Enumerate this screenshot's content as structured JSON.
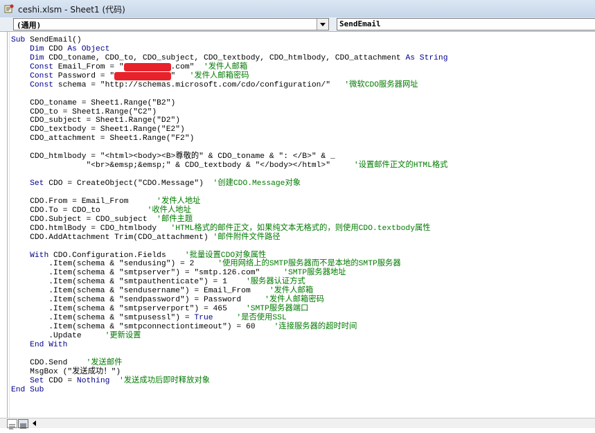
{
  "window": {
    "title": "ceshi.xlsm - Sheet1 (代码)"
  },
  "combos": {
    "object_value": "(通用)",
    "procedure_value": "SendEmail"
  },
  "colors": {
    "keyword": "#00008b",
    "comment": "#007a00",
    "text": "#000000",
    "redaction": "#e8222a"
  },
  "code_lines": [
    [
      {
        "t": "Sub ",
        "k": "kw"
      },
      {
        "t": "SendEmail()",
        "k": "tx"
      }
    ],
    [
      {
        "t": "    Dim ",
        "k": "kw"
      },
      {
        "t": "CDO ",
        "k": "tx"
      },
      {
        "t": "As Object",
        "k": "kw"
      }
    ],
    [
      {
        "t": "    Dim ",
        "k": "kw"
      },
      {
        "t": "CDO_toname, CDO_to, CDO_subject, CDO_textbody, CDO_htmlbody, CDO_attachment ",
        "k": "tx"
      },
      {
        "t": "As String",
        "k": "kw"
      }
    ],
    [
      {
        "t": "    Const ",
        "k": "kw"
      },
      {
        "t": "Email_From = \"",
        "k": "tx"
      },
      {
        "t": "xxxxxxxxxx",
        "k": "redact"
      },
      {
        "t": ".com\"  ",
        "k": "tx"
      },
      {
        "t": "'发件人邮箱",
        "k": "cm"
      }
    ],
    [
      {
        "t": "    Const ",
        "k": "kw"
      },
      {
        "t": "Password = \"",
        "k": "tx"
      },
      {
        "t": "xxxxxxxxxxxx",
        "k": "redact"
      },
      {
        "t": "\"   ",
        "k": "tx"
      },
      {
        "t": "'发件人邮箱密码",
        "k": "cm"
      }
    ],
    [
      {
        "t": "    Const ",
        "k": "kw"
      },
      {
        "t": "schema = \"http://schemas.microsoft.com/cdo/configuration/\"   ",
        "k": "tx"
      },
      {
        "t": "'微软CDO服务器网址",
        "k": "cm"
      }
    ],
    [
      {
        "t": "",
        "k": "tx"
      }
    ],
    [
      {
        "t": "    CDO_toname = Sheet1.Range(\"B2\")",
        "k": "tx"
      }
    ],
    [
      {
        "t": "    CDO_to = Sheet1.Range(\"C2\")",
        "k": "tx"
      }
    ],
    [
      {
        "t": "    CDO_subject = Sheet1.Range(\"D2\")",
        "k": "tx"
      }
    ],
    [
      {
        "t": "    CDO_textbody = Sheet1.Range(\"E2\")",
        "k": "tx"
      }
    ],
    [
      {
        "t": "    CDO_attachment = Sheet1.Range(\"F2\")",
        "k": "tx"
      }
    ],
    [
      {
        "t": "",
        "k": "tx"
      }
    ],
    [
      {
        "t": "    CDO_htmlbody = \"<html><body><B>尊敬的\" & CDO_toname & \": </B>\" & _",
        "k": "tx"
      }
    ],
    [
      {
        "t": "                \"<br>&emsp;&emsp;\" & CDO_textbody & \"</body></html>\"     ",
        "k": "tx"
      },
      {
        "t": "'设置邮件正文的HTML格式",
        "k": "cm"
      }
    ],
    [
      {
        "t": "",
        "k": "tx"
      }
    ],
    [
      {
        "t": "    Set ",
        "k": "kw"
      },
      {
        "t": "CDO = CreateObject(\"CDO.Message\")  ",
        "k": "tx"
      },
      {
        "t": "'创建CDO.Message对象",
        "k": "cm"
      }
    ],
    [
      {
        "t": "",
        "k": "tx"
      }
    ],
    [
      {
        "t": "    CDO.From = Email_From      ",
        "k": "tx"
      },
      {
        "t": "'发件人地址",
        "k": "cm"
      }
    ],
    [
      {
        "t": "    CDO.To = CDO_to          ",
        "k": "tx"
      },
      {
        "t": "'收件人地址",
        "k": "cm"
      }
    ],
    [
      {
        "t": "    CDO.Subject = CDO_subject  ",
        "k": "tx"
      },
      {
        "t": "'邮件主题",
        "k": "cm"
      }
    ],
    [
      {
        "t": "    CDO.htmlBody = CDO_htmlbody   ",
        "k": "tx"
      },
      {
        "t": "'HTML格式的邮件正文，如果纯文本无格式的，则使用CDO.textbody属性",
        "k": "cm"
      }
    ],
    [
      {
        "t": "    CDO.AddAttachment Trim(CDO_attachment) ",
        "k": "tx"
      },
      {
        "t": "'邮件附件文件路径",
        "k": "cm"
      }
    ],
    [
      {
        "t": "",
        "k": "tx"
      }
    ],
    [
      {
        "t": "    With ",
        "k": "kw"
      },
      {
        "t": "CDO.Configuration.Fields    ",
        "k": "tx"
      },
      {
        "t": "'批量设置CDO对象属性",
        "k": "cm"
      }
    ],
    [
      {
        "t": "        .Item(schema & \"sendusing\") = 2     ",
        "k": "tx"
      },
      {
        "t": "'使用网络上的SMTP服务器而不是本地的SMTP服务器",
        "k": "cm"
      }
    ],
    [
      {
        "t": "        .Item(schema & \"smtpserver\") = \"smtp.126.com\"     ",
        "k": "tx"
      },
      {
        "t": "'SMTP服务器地址",
        "k": "cm"
      }
    ],
    [
      {
        "t": "        .Item(schema & \"smtpauthenticate\") = 1    ",
        "k": "tx"
      },
      {
        "t": "'服务器认证方式",
        "k": "cm"
      }
    ],
    [
      {
        "t": "        .Item(schema & \"sendusername\") = Email_From    ",
        "k": "tx"
      },
      {
        "t": "'发件人邮箱",
        "k": "cm"
      }
    ],
    [
      {
        "t": "        .Item(schema & \"sendpassword\") = Password     ",
        "k": "tx"
      },
      {
        "t": "'发件人邮箱密码",
        "k": "cm"
      }
    ],
    [
      {
        "t": "        .Item(schema & \"smtpserverport\") = 465    ",
        "k": "tx"
      },
      {
        "t": "'SMTP服务器端口",
        "k": "cm"
      }
    ],
    [
      {
        "t": "        .Item(schema & \"smtpusessl\") = ",
        "k": "tx"
      },
      {
        "t": "True",
        "k": "kw"
      },
      {
        "t": "     ",
        "k": "tx"
      },
      {
        "t": "'是否使用SSL",
        "k": "cm"
      }
    ],
    [
      {
        "t": "        .Item(schema & \"smtpconnectiontimeout\") = 60    ",
        "k": "tx"
      },
      {
        "t": "'连接服务器的超时时间",
        "k": "cm"
      }
    ],
    [
      {
        "t": "        .Update     ",
        "k": "tx"
      },
      {
        "t": "'更新设置",
        "k": "cm"
      }
    ],
    [
      {
        "t": "    End With",
        "k": "kw"
      }
    ],
    [
      {
        "t": "",
        "k": "tx"
      }
    ],
    [
      {
        "t": "    CDO.Send    ",
        "k": "tx"
      },
      {
        "t": "'发送邮件",
        "k": "cm"
      }
    ],
    [
      {
        "t": "    MsgBox (\"发送成功！\")",
        "k": "tx"
      }
    ],
    [
      {
        "t": "    Set ",
        "k": "kw"
      },
      {
        "t": "CDO = ",
        "k": "tx"
      },
      {
        "t": "Nothing",
        "k": "kw"
      },
      {
        "t": "  ",
        "k": "tx"
      },
      {
        "t": "'发送成功后即时释放对象",
        "k": "cm"
      }
    ],
    [
      {
        "t": "End Sub",
        "k": "kw"
      }
    ]
  ]
}
